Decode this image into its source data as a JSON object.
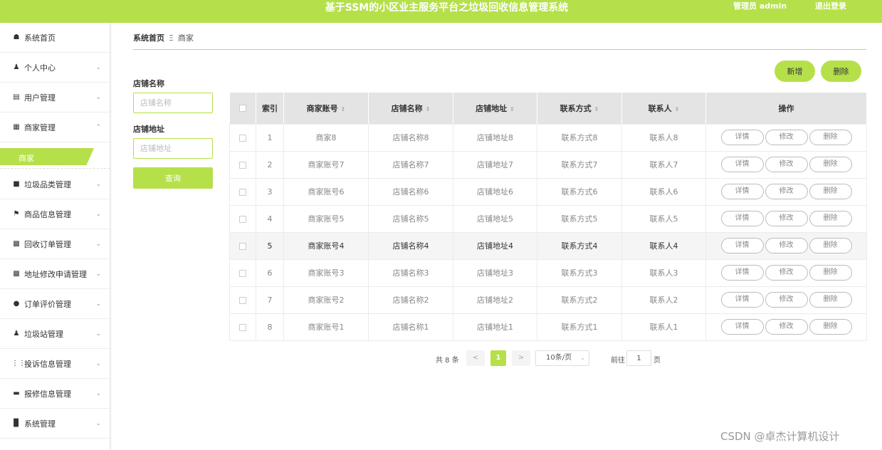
{
  "header": {
    "title": "基于SSM的小区业主服务平台之垃圾回收信息管理系统",
    "admin": "管理员 admin",
    "logout": "退出登录"
  },
  "sidebar": {
    "items": [
      {
        "label": "系统首页",
        "icon": "home-icon"
      },
      {
        "label": "个人中心",
        "icon": "user-icon"
      },
      {
        "label": "用户管理",
        "icon": "chart-icon"
      },
      {
        "label": "商家管理",
        "icon": "clipboard-icon"
      },
      {
        "label": "垃圾品类管理",
        "icon": "briefcase-icon"
      },
      {
        "label": "商品信息管理",
        "icon": "flag-icon"
      },
      {
        "label": "回收订单管理",
        "icon": "grid-icon"
      },
      {
        "label": "地址修改申请管理",
        "icon": "grid-icon"
      },
      {
        "label": "订单评价管理",
        "icon": "pin-icon"
      },
      {
        "label": "垃圾站管理",
        "icon": "user-stand-icon"
      },
      {
        "label": "投诉信息管理",
        "icon": "dots-icon"
      },
      {
        "label": "报修信息管理",
        "icon": "monitor-icon"
      },
      {
        "label": "系统管理",
        "icon": "bars-icon"
      }
    ],
    "sub_item": "商家"
  },
  "breadcrumb": {
    "home": "系统首页",
    "separator": "Ξ",
    "current": "商家"
  },
  "filters": {
    "store_name_label": "店铺名称",
    "store_name_placeholder": "店铺名称",
    "store_address_label": "店铺地址",
    "store_address_placeholder": "店铺地址",
    "search_button": "查询"
  },
  "actions": {
    "add": "新增",
    "delete": "删除"
  },
  "table": {
    "headers": [
      "索引",
      "商家账号",
      "店铺名称",
      "店铺地址",
      "联系方式",
      "联系人",
      "操作"
    ],
    "rows": [
      {
        "index": "1",
        "account": "商家8",
        "name": "店铺名称8",
        "address": "店铺地址8",
        "contact": "联系方式8",
        "person": "联系人8"
      },
      {
        "index": "2",
        "account": "商家账号7",
        "name": "店铺名称7",
        "address": "店铺地址7",
        "contact": "联系方式7",
        "person": "联系人7"
      },
      {
        "index": "3",
        "account": "商家账号6",
        "name": "店铺名称6",
        "address": "店铺地址6",
        "contact": "联系方式6",
        "person": "联系人6"
      },
      {
        "index": "4",
        "account": "商家账号5",
        "name": "店铺名称5",
        "address": "店铺地址5",
        "contact": "联系方式5",
        "person": "联系人5"
      },
      {
        "index": "5",
        "account": "商家账号4",
        "name": "店铺名称4",
        "address": "店铺地址4",
        "contact": "联系方式4",
        "person": "联系人4"
      },
      {
        "index": "6",
        "account": "商家账号3",
        "name": "店铺名称3",
        "address": "店铺地址3",
        "contact": "联系方式3",
        "person": "联系人3"
      },
      {
        "index": "7",
        "account": "商家账号2",
        "name": "店铺名称2",
        "address": "店铺地址2",
        "contact": "联系方式2",
        "person": "联系人2"
      },
      {
        "index": "8",
        "account": "商家账号1",
        "name": "店铺名称1",
        "address": "店铺地址1",
        "contact": "联系方式1",
        "person": "联系人1"
      }
    ],
    "row_actions": {
      "detail": "详情",
      "edit": "修改",
      "delete": "删除"
    },
    "highlight_row": 5
  },
  "pagination": {
    "total": "共 8 条",
    "prev": "<",
    "current_page": "1",
    "next": ">",
    "page_size": "10条/页",
    "goto_label": "前往",
    "goto_value": "1",
    "goto_suffix": "页"
  },
  "watermark": "CSDN @卓杰计算机设计",
  "colors": {
    "accent": "#b5e04a"
  }
}
